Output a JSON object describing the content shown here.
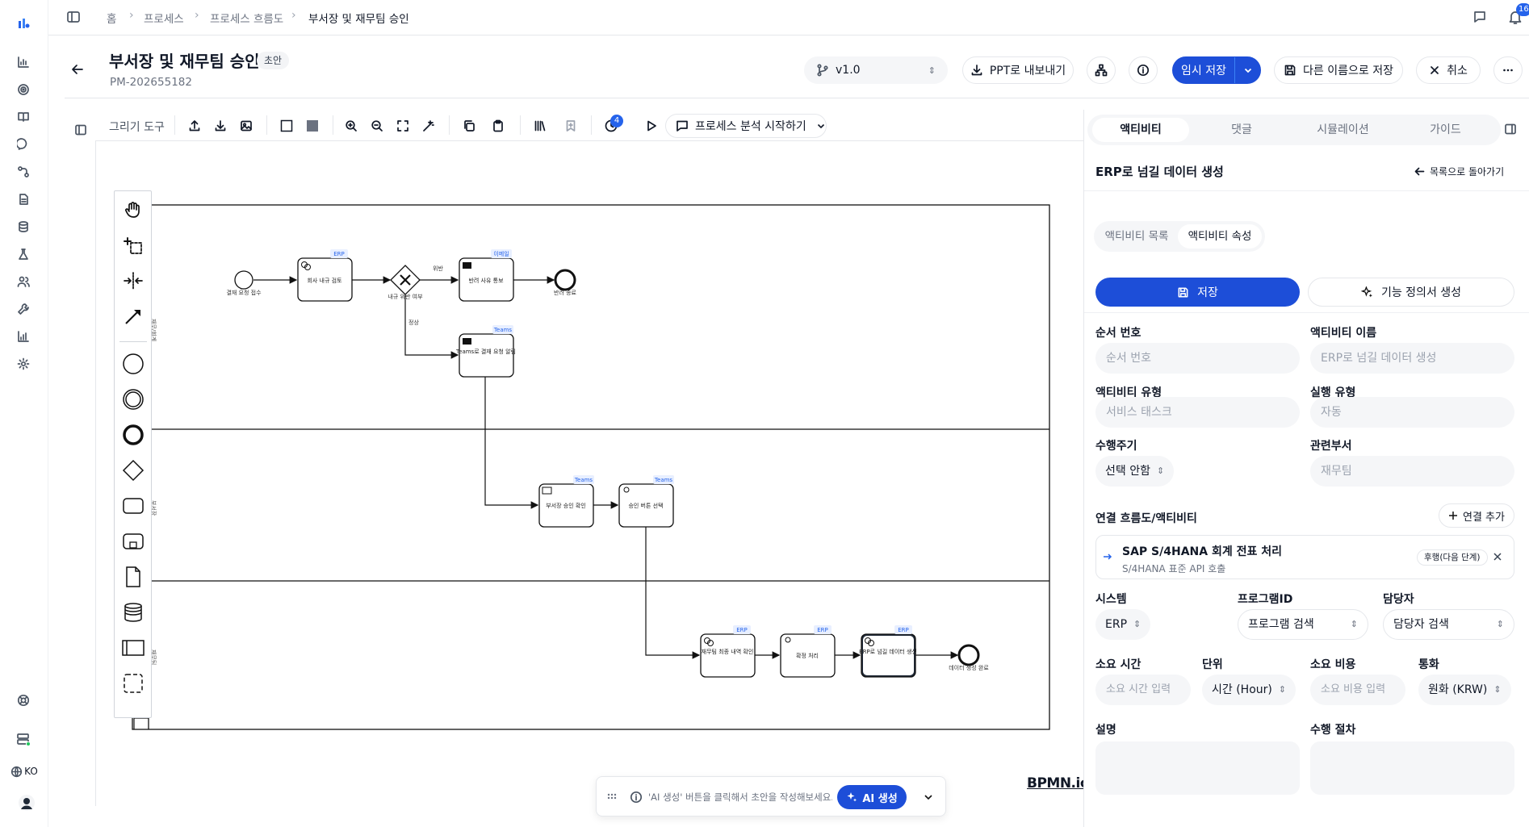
{
  "breadcrumb": [
    "홈",
    "프로세스",
    "프로세스 흐름도",
    "부서장 및 재무팀 승인"
  ],
  "notification_count": "16",
  "language": "KO",
  "header": {
    "title": "부서장 및 재무팀 승인",
    "status_badge": "초안",
    "doc_id": "PM-202655182",
    "version": "v1.0",
    "export_ppt": "PPT로 내보내기",
    "temp_save": "임시 저장",
    "save_as": "다른 이름으로 저장",
    "cancel": "취소"
  },
  "toolbar": {
    "drawing_tools": "그리기 도구",
    "notification_badge": "4",
    "analysis_button": "프로세스 분석 시작하기"
  },
  "diagram": {
    "lane_labels": [
      "재무/회계",
      "부서장",
      "재무팀"
    ],
    "start_event": "결재 요청 접수",
    "task_review": "회사 내규 검토",
    "task_review_tag": "ERP",
    "gateway": "내규 위반 여부",
    "flow_violation": "위반",
    "flow_normal": "정상",
    "task_notify": "반려 사유 통보",
    "task_notify_tag": "이메일",
    "end_reject": "반려 종료",
    "task_teams": "Teams로 결재 요청 알림",
    "task_teams_tag": "Teams",
    "task_dept_confirm": "부서장 승인 확인",
    "task_dept_confirm_tag": "Teams",
    "task_approve_select": "승인 버튼 선택",
    "task_approve_select_tag": "Teams",
    "task_finance_confirm": "재무팀 최종 내역 확인",
    "task_finance_confirm_tag": "ERP",
    "task_post": "확정 처리",
    "task_post_tag": "ERP",
    "task_erp": "ERP로 넘길 데이터 생성",
    "task_erp_tag": "ERP",
    "end_final": "데이터 생성 완료"
  },
  "panel": {
    "tabs": [
      "액티비티",
      "댓글",
      "시뮬레이션",
      "가이드"
    ],
    "section_title": "ERP로 넘길 데이터 생성",
    "back_to_list": "목록으로 돌아가기",
    "subtabs": [
      "액티비티 목록",
      "액티비티 속성"
    ],
    "save": "저장",
    "gen_spec": "기능 정의서 생성",
    "order_label": "순서 번호",
    "order_placeholder": "순서 번호",
    "name_label": "액티비티 이름",
    "name_value": "ERP로 넘길 데이터 생성",
    "type_label": "액티비티 유형",
    "type_value": "서비스 태스크",
    "exec_label": "실행 유형",
    "exec_value": "자동",
    "cycle_label": "수행주기",
    "cycle_value": "선택 안함",
    "dept_label": "관련부서",
    "dept_value": "재무팀",
    "link_label": "연결 흐름도/액티비티",
    "link_add": "연결 추가",
    "link_title": "SAP S/4HANA 회계 전표 처리",
    "link_sub": "S/4HANA 표준 API 호출",
    "link_badge": "후행(다음 단계)",
    "system_label": "시스템",
    "system_value": "ERP",
    "program_label": "프로그램ID",
    "program_value": "프로그램 검색",
    "owner_label": "담당자",
    "owner_value": "담당자 검색",
    "time_label": "소요 시간",
    "time_placeholder": "소요 시간 입력",
    "unit_label": "단위",
    "unit_value": "시간 (Hour)",
    "cost_label": "소요 비용",
    "cost_placeholder": "소요 비용 입력",
    "currency_label": "통화",
    "currency_value": "원화 (KRW)",
    "desc_label": "설명",
    "proc_label": "수행 절차"
  },
  "ai_bar": {
    "hint": "'AI 생성' 버튼을 클릭해서 초안을 작성해보세요.",
    "button": "AI 생성"
  },
  "watermark": "BPMN.io"
}
